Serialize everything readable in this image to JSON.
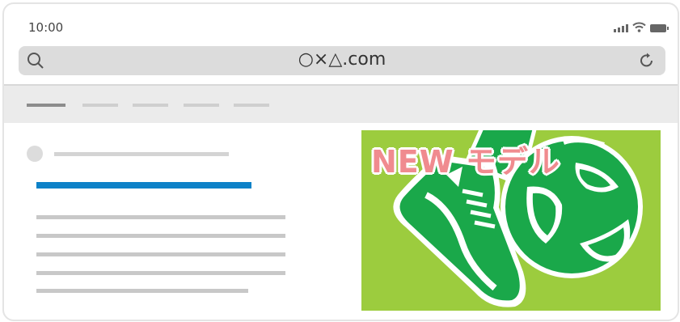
{
  "status": {
    "time": "10:00",
    "icons": [
      "signal-icon",
      "wifi-icon",
      "battery-icon"
    ]
  },
  "browser": {
    "url": "○×△.com",
    "icons": [
      "search-icon",
      "reload-icon"
    ]
  },
  "ad": {
    "headline": "NEW モデル"
  },
  "colors": {
    "accent": "#0d82c8",
    "ad_background": "#9ccc3e",
    "ad_text": "#f08b8f",
    "shoe_green": "#1aa84a"
  }
}
